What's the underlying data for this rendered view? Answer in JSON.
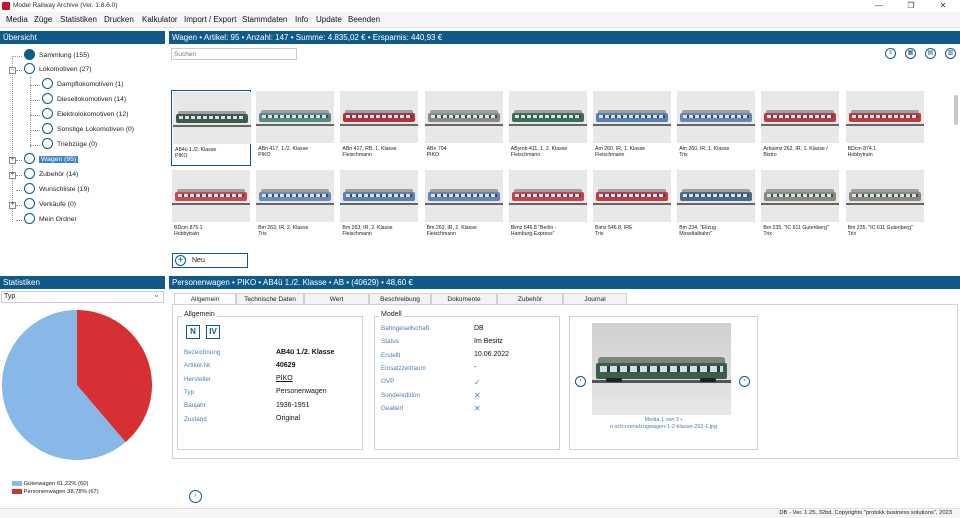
{
  "window": {
    "title": "Model Railway Archive (Ver. 1.8.6.0)",
    "minimize": "—",
    "restore": "❐",
    "close": "✕"
  },
  "menu": [
    "Media",
    "Züge",
    "Statistiken",
    "Drucken",
    "Kalkulator",
    "Import / Export",
    "Stammdaten",
    "Info",
    "Update",
    "Beenden"
  ],
  "overview": {
    "title": "Übersicht",
    "tree": [
      {
        "label": "Sammlung (155)"
      },
      {
        "label": "Lokomotiven (27)"
      },
      {
        "label": "Dampflokomotiven (1)"
      },
      {
        "label": "Diesellokomotiven (14)"
      },
      {
        "label": "Elektrolokomotiven (12)"
      },
      {
        "label": "Sonstige Lokomotiven (0)"
      },
      {
        "label": "Triebzüge (0)"
      },
      {
        "label": "Wagen (95)",
        "selected": true
      },
      {
        "label": "Zubehör (14)"
      },
      {
        "label": "Wunschliste (19)"
      },
      {
        "label": "Verkäufe (0)"
      },
      {
        "label": "Mein Ordner"
      }
    ]
  },
  "statistics": {
    "title": "Statistiken",
    "dropdown_value": "Typ",
    "chevron": "⌄",
    "legend": [
      {
        "label": "Güterwagen 61,22% (60)",
        "color": "#88b8e8",
        "value": 61.22
      },
      {
        "label": "Personenwagen 38,78% (67)",
        "color": "#d73034",
        "value": 38.78
      }
    ]
  },
  "catalog": {
    "title": "Wagen • Artikel: 95 • Anzahl: 147 • Summe: 4.835,02 € • Ersparnis: 440,93 €",
    "search_placeholder": "Suchen",
    "new_button": "Neu",
    "new_icon": "+",
    "view_icons": [
      "≡",
      "▦",
      "▤",
      "▥"
    ],
    "cards": [
      {
        "caption": "AB4ü 1./2. Klasse\nPIKO",
        "color": "#3d5c4a",
        "selected": true
      },
      {
        "caption": "ABn 417, 1./2. Klasse\nPIKO",
        "color": "#5a8a80"
      },
      {
        "caption": "ABn 417, RB, 1. Klasse\nFleischmann",
        "color": "#b8303a"
      },
      {
        "caption": "ABn 704\nPIKO",
        "color": "#8a8a80"
      },
      {
        "caption": "ABymb 411, 1. 2. Klasse\nFleischmann",
        "color": "#3e6e50"
      },
      {
        "caption": "Am 260, IR, 1. Klasse\nFleischmann",
        "color": "#5a7fb0"
      },
      {
        "caption": "Am 260, IR, 1. Klasse\nTrix",
        "color": "#6a84b8"
      },
      {
        "caption": "Arbuimz 262, IR, 1. Klasse /\nBistro",
        "color": "#b83a40"
      },
      {
        "caption": "BDcm 874.1\nHobbytrain",
        "color": "#c03a3a"
      },
      {
        "caption": "BDcm 875.1\nHobbytrain",
        "color": "#c84a4a"
      },
      {
        "caption": "Bm 263, IR, 2. Klasse\nTrix",
        "color": "#6a8ab8"
      },
      {
        "caption": "Bm 263, IR, 2. Klasse\nFleischmann",
        "color": "#5a7fb0"
      },
      {
        "caption": "Bm 263, IR, 2. Klasse\nFleischmann",
        "color": "#6584b4"
      },
      {
        "caption": "Bimz 546.8 \"Berlin -\nHamburg-Express\"",
        "color": "#c8404a"
      },
      {
        "caption": "Bimz 546.8, IRE\nTrix",
        "color": "#c03a44"
      },
      {
        "caption": "Bm 234, \"Eilzug\nMoseltalbahn\"",
        "color": "#4a6a8a"
      },
      {
        "caption": "Bm 235, \"IC 611 Gutenberg\"\nTrix",
        "color": "#8a8a7a"
      },
      {
        "caption": "Bm 235, \"IC 611 Gutenberg\"\nTrix",
        "color": "#8a8a7a"
      }
    ]
  },
  "detail": {
    "title": "Personenwagen • PIKO • AB4ü 1./2. Klasse • AB • (40629) • 48,60 €",
    "tabs": [
      "Allgemein",
      "Technische Daten",
      "Wert",
      "Beschreibung",
      "Dokumente",
      "Zubehör",
      "Journal"
    ],
    "general": {
      "title": "Allgemein",
      "badges": [
        "N",
        "IV"
      ],
      "fields": [
        {
          "label": "Bezeichnung",
          "value": "AB4ü 1./2. Klasse",
          "style": "b"
        },
        {
          "label": "Artikel-Nr.",
          "value": "40629",
          "style": "b"
        },
        {
          "label": "Hersteller",
          "value": "PIKO",
          "style": "u"
        },
        {
          "label": "Typ",
          "value": "Personenwagen",
          "style": ""
        },
        {
          "label": "Baujahr",
          "value": "1936-1951",
          "style": ""
        },
        {
          "label": "Zustand",
          "value": "Original",
          "style": ""
        }
      ]
    },
    "model": {
      "title": "Modell",
      "fields": [
        {
          "label": "Bahngesellschaft",
          "value": "DB"
        },
        {
          "label": "Status",
          "value": "Im Besitz"
        },
        {
          "label": "Erstellt",
          "value": "10.06.2022"
        },
        {
          "label": "Einsatzzeitraum",
          "value": "-"
        },
        {
          "label": "OVP",
          "value": "✓"
        },
        {
          "label": "Sonderedition",
          "value": "✕"
        },
        {
          "label": "Gealtert",
          "value": "✕"
        }
      ]
    },
    "media": {
      "caption_line1": "Media 1 von 2 •",
      "caption_line2": "n-sch-rzenelzugwagen-1-2-klasse-292-1.jpg",
      "prev": "‹",
      "next": "›"
    },
    "bottom_next": "›"
  },
  "statusbar": {
    "text": "DB - Ver. 1.25, 32bit. Copyrights \"protokk business solutions\", 2023"
  },
  "chart_data": {
    "type": "pie",
    "categories": [
      "Güterwagen",
      "Personenwagen"
    ],
    "values": [
      61.22,
      38.78
    ],
    "counts": [
      60,
      67
    ],
    "colors": [
      "#88b8e8",
      "#d73034"
    ],
    "legend": "bottom-left"
  }
}
